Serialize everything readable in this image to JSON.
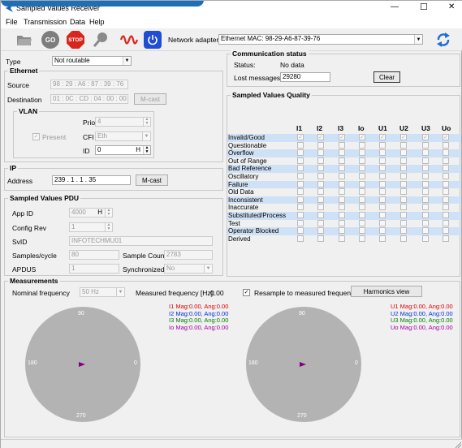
{
  "window": {
    "title": "Sampled Values Receiver",
    "overlay_logo_text": "[partial logo text cut off at top]",
    "controls": {
      "minimize": "—",
      "maximize": "☐",
      "close": "✕"
    }
  },
  "menu": [
    "File",
    "Transmission",
    "Data",
    "Help"
  ],
  "toolbar": {
    "go_label": "GO",
    "stop_label": "STOP",
    "adapter_label": "Network adapter",
    "adapter_value": "Ethernet MAC: 98-29-A6-87-39-76"
  },
  "type": {
    "label": "Type",
    "value": "Not routable"
  },
  "ethernet": {
    "title": "Ethernet",
    "source_label": "Source",
    "source_value": "98 : 29 : A6 : 87 : 39 : 76",
    "dest_label": "Destination",
    "dest_value": "01 : 0C : CD : 04 : 00 : 00",
    "mcast_label": "M-cast"
  },
  "vlan": {
    "title": "VLAN",
    "present_label": "Present",
    "priority_label": "Priority",
    "priority_value": "4",
    "cfi_label": "CFI",
    "cfi_value": "Eth",
    "id_label": "ID",
    "id_value": "0",
    "id_suffix": "H"
  },
  "ip": {
    "title": "IP",
    "address_label": "Address",
    "address_value": "239 .   1  .   1  .  35",
    "mcast_label": "M-cast"
  },
  "pdu": {
    "title": "Sampled Values PDU",
    "appid_label": "App ID",
    "appid_value": "4000",
    "appid_suffix": "H",
    "configrev_label": "Config Rev",
    "configrev_value": "1",
    "svid_label": "SvID",
    "svid_value": "INFOTECHMU01",
    "samples_label": "Samples/cycle",
    "samples_value": "80",
    "samplecount_label": "Sample Count",
    "samplecount_value": "2783",
    "apdus_label": "APDUS",
    "apdus_value": "1",
    "sync_label": "Synchronized",
    "sync_value": "No"
  },
  "comm": {
    "title": "Communication status",
    "status_label": "Status:",
    "status_value": "No data",
    "lost_label": "Lost messages",
    "lost_value": "29280",
    "clear_label": "Clear"
  },
  "quality": {
    "title": "Sampled Values Quality",
    "columns": [
      "I1",
      "I2",
      "I3",
      "Io",
      "U1",
      "U2",
      "U3",
      "Uo"
    ],
    "rows": [
      {
        "label": "Invalid/Good",
        "checked": true
      },
      {
        "label": "Questionable",
        "checked": false
      },
      {
        "label": "Overflow",
        "checked": false
      },
      {
        "label": "Out of Range",
        "checked": false
      },
      {
        "label": "Bad Reference",
        "checked": false
      },
      {
        "label": "Oscillatory",
        "checked": false
      },
      {
        "label": "Failure",
        "checked": false
      },
      {
        "label": "Old Data",
        "checked": false
      },
      {
        "label": "Inconsistent",
        "checked": false
      },
      {
        "label": "Inaccurate",
        "checked": false
      },
      {
        "label": "Substituted/Process",
        "checked": false
      },
      {
        "label": "Test",
        "checked": false
      },
      {
        "label": "Operator Blocked",
        "checked": false
      },
      {
        "label": "Derived",
        "checked": false
      }
    ]
  },
  "measurements": {
    "title": "Measurements",
    "nominal_label": "Nominal frequency",
    "nominal_value": "50 Hz",
    "measured_label": "Measured frequency [Hz]:",
    "measured_value": "0.00",
    "resample_label": "Resample to measured frequency",
    "harmonics_label": "Harmonics view",
    "angles": {
      "top": "90",
      "left": "180",
      "right": "0",
      "bottom": "270"
    },
    "current_legend": [
      {
        "text": "I1 Mag:0.00, Ang:0.00",
        "color": "#e00000"
      },
      {
        "text": "I2 Mag:0.00, Ang:0.00",
        "color": "#0030e0"
      },
      {
        "text": "I3 Mag:0.00, Ang:0.00",
        "color": "#008000"
      },
      {
        "text": "Io Mag:0.00, Ang:0.00",
        "color": "#a000a0"
      }
    ],
    "voltage_legend": [
      {
        "text": "U1 Mag:0.00, Ang:0.00",
        "color": "#e00000"
      },
      {
        "text": "U2 Mag:0.00, Ang:0.00",
        "color": "#0030e0"
      },
      {
        "text": "U3 Mag:0.00, Ang:0.00",
        "color": "#008000"
      },
      {
        "text": "Uo Mag:0.00, Ang:0.00",
        "color": "#a000a0"
      }
    ]
  }
}
